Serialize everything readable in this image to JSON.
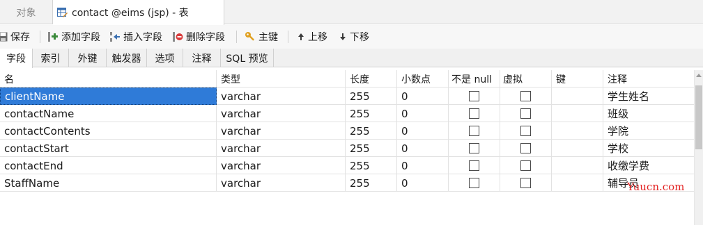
{
  "doc_tabs": {
    "objects_label": "对象",
    "active_label": "contact @eims (jsp) - 表"
  },
  "toolbar": {
    "save": "保存",
    "add_field": "添加字段",
    "insert_field": "插入字段",
    "delete_field": "删除字段",
    "primary_key": "主键",
    "move_up": "上移",
    "move_down": "下移"
  },
  "sub_tabs": [
    "字段",
    "索引",
    "外键",
    "触发器",
    "选项",
    "注释",
    "SQL 预览"
  ],
  "grid": {
    "columns": [
      "名",
      "类型",
      "长度",
      "小数点",
      "不是 null",
      "虚拟",
      "键",
      "注释"
    ],
    "rows": [
      {
        "name": "clientName",
        "type": "varchar",
        "length": "255",
        "decimals": "0",
        "not_null": false,
        "virtual": false,
        "key": "",
        "comment": "学生姓名"
      },
      {
        "name": "contactName",
        "type": "varchar",
        "length": "255",
        "decimals": "0",
        "not_null": false,
        "virtual": false,
        "key": "",
        "comment": "班级"
      },
      {
        "name": "contactContents",
        "type": "varchar",
        "length": "255",
        "decimals": "0",
        "not_null": false,
        "virtual": false,
        "key": "",
        "comment": "学院"
      },
      {
        "name": "contactStart",
        "type": "varchar",
        "length": "255",
        "decimals": "0",
        "not_null": false,
        "virtual": false,
        "key": "",
        "comment": "学校"
      },
      {
        "name": "contactEnd",
        "type": "varchar",
        "length": "255",
        "decimals": "0",
        "not_null": false,
        "virtual": false,
        "key": "",
        "comment": "收缴学费"
      },
      {
        "name": "StaffName",
        "type": "varchar",
        "length": "255",
        "decimals": "0",
        "not_null": false,
        "virtual": false,
        "key": "",
        "comment": "辅导员"
      }
    ]
  },
  "watermark": "Yuucn.com",
  "colors": {
    "selection": "#2f7bd8",
    "watermark": "#e32222"
  }
}
